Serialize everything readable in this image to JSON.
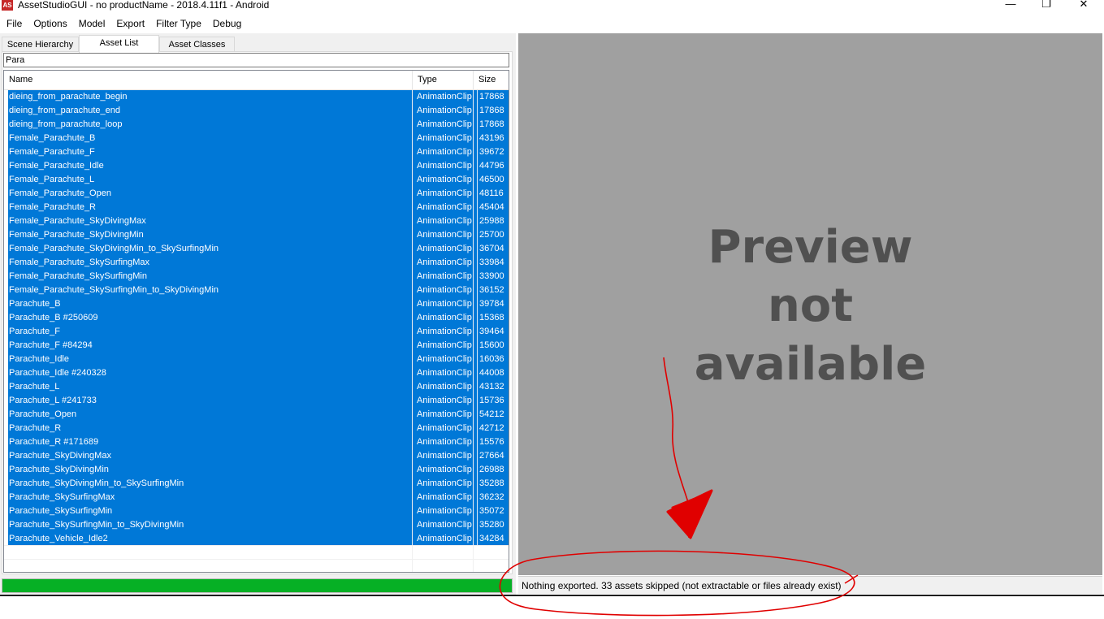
{
  "window": {
    "icon_text": "AS",
    "title": "AssetStudioGUI - no productName - 2018.4.11f1 - Android",
    "minimize": "—",
    "maximize": "❐",
    "close": "✕"
  },
  "menu": [
    "File",
    "Options",
    "Model",
    "Export",
    "Filter Type",
    "Debug"
  ],
  "tabs": [
    {
      "label": "Scene Hierarchy",
      "active": false
    },
    {
      "label": "Asset List",
      "active": true
    },
    {
      "label": "Asset Classes",
      "active": false
    }
  ],
  "filter": {
    "value": "Para"
  },
  "columns": {
    "name": "Name",
    "type": "Type",
    "size": "Size"
  },
  "assets": [
    {
      "name": "dieing_from_parachute_begin",
      "type": "AnimationClip",
      "size": "17868"
    },
    {
      "name": "dieing_from_parachute_end",
      "type": "AnimationClip",
      "size": "17868"
    },
    {
      "name": "dieing_from_parachute_loop",
      "type": "AnimationClip",
      "size": "17868"
    },
    {
      "name": "Female_Parachute_B",
      "type": "AnimationClip",
      "size": "43196"
    },
    {
      "name": "Female_Parachute_F",
      "type": "AnimationClip",
      "size": "39672"
    },
    {
      "name": "Female_Parachute_Idle",
      "type": "AnimationClip",
      "size": "44796"
    },
    {
      "name": "Female_Parachute_L",
      "type": "AnimationClip",
      "size": "46500"
    },
    {
      "name": "Female_Parachute_Open",
      "type": "AnimationClip",
      "size": "48116"
    },
    {
      "name": "Female_Parachute_R",
      "type": "AnimationClip",
      "size": "45404"
    },
    {
      "name": "Female_Parachute_SkyDivingMax",
      "type": "AnimationClip",
      "size": "25988"
    },
    {
      "name": "Female_Parachute_SkyDivingMin",
      "type": "AnimationClip",
      "size": "25700"
    },
    {
      "name": "Female_Parachute_SkyDivingMin_to_SkySurfingMin",
      "type": "AnimationClip",
      "size": "36704"
    },
    {
      "name": "Female_Parachute_SkySurfingMax",
      "type": "AnimationClip",
      "size": "33984"
    },
    {
      "name": "Female_Parachute_SkySurfingMin",
      "type": "AnimationClip",
      "size": "33900"
    },
    {
      "name": "Female_Parachute_SkySurfingMin_to_SkyDivingMin",
      "type": "AnimationClip",
      "size": "36152"
    },
    {
      "name": "Parachute_B",
      "type": "AnimationClip",
      "size": "39784"
    },
    {
      "name": "Parachute_B #250609",
      "type": "AnimationClip",
      "size": "15368"
    },
    {
      "name": "Parachute_F",
      "type": "AnimationClip",
      "size": "39464"
    },
    {
      "name": "Parachute_F #84294",
      "type": "AnimationClip",
      "size": "15600"
    },
    {
      "name": "Parachute_Idle",
      "type": "AnimationClip",
      "size": "16036"
    },
    {
      "name": "Parachute_Idle #240328",
      "type": "AnimationClip",
      "size": "44008"
    },
    {
      "name": "Parachute_L",
      "type": "AnimationClip",
      "size": "43132"
    },
    {
      "name": "Parachute_L #241733",
      "type": "AnimationClip",
      "size": "15736"
    },
    {
      "name": "Parachute_Open",
      "type": "AnimationClip",
      "size": "54212"
    },
    {
      "name": "Parachute_R",
      "type": "AnimationClip",
      "size": "42712"
    },
    {
      "name": "Parachute_R #171689",
      "type": "AnimationClip",
      "size": "15576"
    },
    {
      "name": "Parachute_SkyDivingMax",
      "type": "AnimationClip",
      "size": "27664"
    },
    {
      "name": "Parachute_SkyDivingMin",
      "type": "AnimationClip",
      "size": "26988"
    },
    {
      "name": "Parachute_SkyDivingMin_to_SkySurfingMin",
      "type": "AnimationClip",
      "size": "35288"
    },
    {
      "name": "Parachute_SkySurfingMax",
      "type": "AnimationClip",
      "size": "36232"
    },
    {
      "name": "Parachute_SkySurfingMin",
      "type": "AnimationClip",
      "size": "35072"
    },
    {
      "name": "Parachute_SkySurfingMin_to_SkyDivingMin",
      "type": "AnimationClip",
      "size": "35280"
    },
    {
      "name": "Parachute_Vehicle_Idle2",
      "type": "AnimationClip",
      "size": "34284"
    }
  ],
  "progress": {
    "fraction": 1.0
  },
  "preview": {
    "line1": "Preview",
    "line2": "not",
    "line3": "available"
  },
  "status": "Nothing exported. 33 assets skipped (not extractable or files already exist)",
  "colors": {
    "selection": "#0078d7",
    "progress": "#06b025",
    "preview_bg": "#a0a0a0",
    "preview_text": "#505050",
    "annotation": "#e00000"
  }
}
